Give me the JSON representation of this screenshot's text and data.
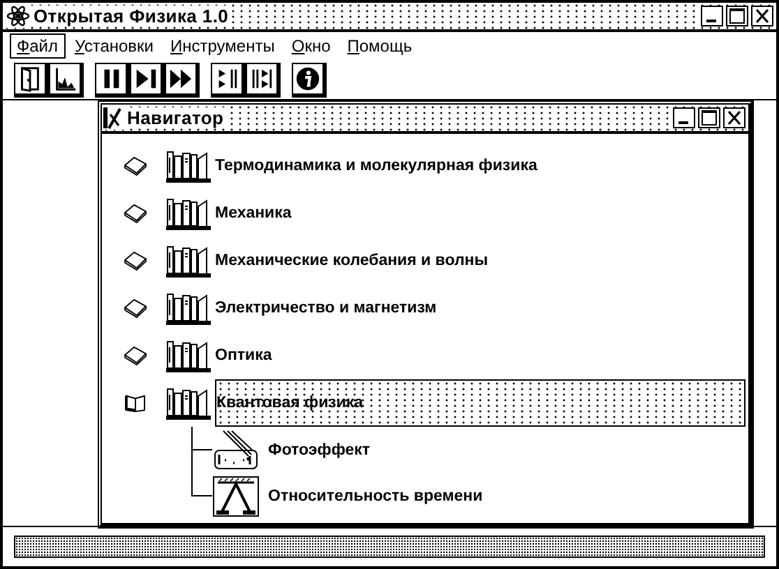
{
  "window": {
    "title": "Открытая Физика 1.0"
  },
  "menu": [
    {
      "label": "Файл",
      "selected": true
    },
    {
      "label": "Установки",
      "selected": false
    },
    {
      "label": "Инструменты",
      "selected": false
    },
    {
      "label": "Окно",
      "selected": false
    },
    {
      "label": "Помощь",
      "selected": false
    }
  ],
  "toolbar": [
    [
      {
        "kind": "door"
      },
      {
        "kind": "graph"
      }
    ],
    [
      {
        "kind": "pause"
      },
      {
        "kind": "step"
      },
      {
        "kind": "fast"
      }
    ],
    [
      {
        "kind": "frames"
      },
      {
        "kind": "frames-step"
      }
    ],
    [
      {
        "kind": "info"
      }
    ]
  ],
  "navigator": {
    "title": "Навигатор",
    "items": [
      {
        "label": "Термодинамика и молекулярная физика",
        "expanded": false,
        "selected": false
      },
      {
        "label": "Механика",
        "expanded": false,
        "selected": false
      },
      {
        "label": "Механические колебания и волны",
        "expanded": false,
        "selected": false
      },
      {
        "label": "Электричество и магнетизм",
        "expanded": false,
        "selected": false
      },
      {
        "label": "Оптика",
        "expanded": false,
        "selected": false
      },
      {
        "label": "Квантовая физика",
        "expanded": true,
        "selected": true,
        "children": [
          {
            "label": "Фотоэффект",
            "kind": "photoeffect"
          },
          {
            "label": "Относительность времени",
            "kind": "relativity"
          }
        ]
      }
    ]
  }
}
